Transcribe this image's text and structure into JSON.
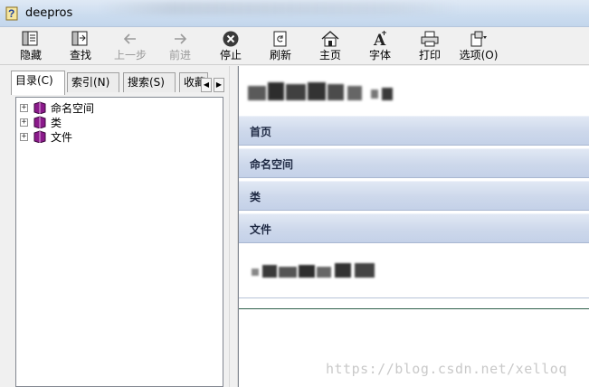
{
  "window": {
    "title": "deepros"
  },
  "toolbar": {
    "buttons": [
      {
        "label": "隐藏",
        "icon": "hide-icon",
        "enabled": true
      },
      {
        "label": "查找",
        "icon": "locate-icon",
        "enabled": true
      },
      {
        "label": "上一步",
        "icon": "back-arrow-icon",
        "enabled": false
      },
      {
        "label": "前进",
        "icon": "forward-arrow-icon",
        "enabled": false
      },
      {
        "label": "停止",
        "icon": "stop-icon",
        "enabled": true
      },
      {
        "label": "刷新",
        "icon": "refresh-icon",
        "enabled": true
      },
      {
        "label": "主页",
        "icon": "home-icon",
        "enabled": true
      },
      {
        "label": "字体",
        "icon": "font-icon",
        "enabled": true
      },
      {
        "label": "打印",
        "icon": "print-icon",
        "enabled": true
      },
      {
        "label": "选项(O)",
        "icon": "options-icon",
        "enabled": true
      }
    ]
  },
  "nav": {
    "tabs": [
      {
        "label": "目录(C)",
        "active": true
      },
      {
        "label": "索引(N)",
        "active": false
      },
      {
        "label": "搜索(S)",
        "active": false
      },
      {
        "label": "收藏",
        "active": false
      }
    ],
    "tree": [
      {
        "label": "命名空间",
        "icon": "book-icon"
      },
      {
        "label": "类",
        "icon": "book-icon"
      },
      {
        "label": "文件",
        "icon": "book-icon"
      }
    ]
  },
  "content": {
    "sections": [
      {
        "title": "首页"
      },
      {
        "title": "命名空间"
      },
      {
        "title": "类"
      },
      {
        "title": "文件"
      }
    ]
  },
  "watermark": "https://blog.csdn.net/xelloq",
  "colors": {
    "section_header": "#cdd8eb",
    "book": "#8b1a8b"
  }
}
